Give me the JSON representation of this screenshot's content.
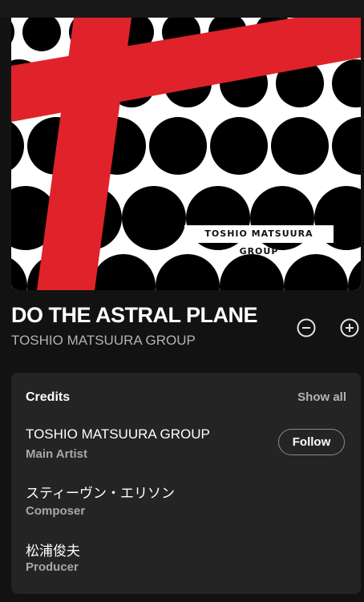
{
  "cover": {
    "label": "TOSHIO MATSUURA GROUP",
    "colors": {
      "background": "#ffffff",
      "dots": "#000000",
      "cross": "#e0222a"
    }
  },
  "track": {
    "title": "DO THE ASTRAL PLANE",
    "artist": "TOSHIO MATSUURA GROUP"
  },
  "actions": {
    "remove_icon": "minus-circle-icon",
    "add_icon": "plus-circle-icon"
  },
  "credits": {
    "heading": "Credits",
    "show_all": "Show all",
    "follow_label": "Follow",
    "items": [
      {
        "name": "TOSHIO MATSUURA GROUP",
        "role": "Main Artist"
      },
      {
        "name": "スティーヴン・エリソン",
        "role": "Composer"
      },
      {
        "name": "松浦俊夫",
        "role": "Producer"
      }
    ]
  },
  "colors": {
    "background": "#121212",
    "card": "#242424",
    "muted_text": "#b3b3b3"
  }
}
